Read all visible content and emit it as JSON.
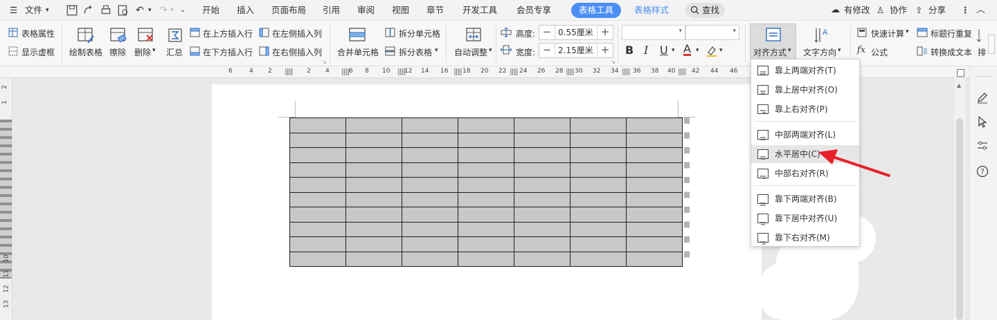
{
  "menubar": {
    "file_label": "文件",
    "tabs": [
      "开始",
      "插入",
      "页面布局",
      "引用",
      "审阅",
      "视图",
      "章节",
      "开发工具",
      "会员专享"
    ],
    "active_tab": "表格工具",
    "style_tab": "表格样式",
    "search_label": "查找",
    "modified_label": "有修改",
    "collab_label": "协作",
    "share_label": "分享"
  },
  "ribbon": {
    "table_props": "表格属性",
    "show_gridlines": "显示虚框",
    "draw_table": "绘制表格",
    "erase": "擦除",
    "delete": "删除",
    "summary": "汇总",
    "insert_row_above": "在上方插入行",
    "insert_row_below": "在下方插入行",
    "insert_col_left": "在左侧插入列",
    "insert_col_right": "在右侧插入列",
    "merge_cells": "合并单元格",
    "split_cells": "拆分单元格",
    "split_table": "拆分表格",
    "auto_fit": "自动调整",
    "height_label": "高度:",
    "height_value": "0.55厘米",
    "width_label": "宽度:",
    "width_value": "2.15厘米",
    "align_mode": "对齐方式",
    "text_direction": "文字方向",
    "quick_calc": "快速计算",
    "repeat_header": "标题行重复",
    "formula": "公式",
    "convert_to_text": "转换成文本",
    "sort_partial": "排",
    "bold": "B",
    "italic": "I",
    "underline": "U",
    "font_color_letter": "A"
  },
  "ruler_ticks": [
    "6",
    "4",
    "2",
    "2",
    "4",
    "6",
    "8",
    "10",
    "12",
    "14",
    "16",
    "18",
    "20",
    "22",
    "24",
    "26",
    "28",
    "30",
    "32",
    "34",
    "36",
    "38",
    "40",
    "42",
    "44",
    "46"
  ],
  "vruler_ticks": [
    "2",
    "1",
    "1",
    "10",
    "11",
    "12",
    "13"
  ],
  "table": {
    "rows": 10,
    "cols": 7
  },
  "dropdown": {
    "items": [
      {
        "label": "靠上两端对齐(T)",
        "icon": "align-top-justify-icon"
      },
      {
        "label": "靠上居中对齐(O)",
        "icon": "align-top-center-icon"
      },
      {
        "label": "靠上右对齐(P)",
        "icon": "align-top-right-icon"
      },
      {
        "label": "中部两端对齐(L)",
        "icon": "align-middle-justify-icon"
      },
      {
        "label": "水平居中(C)",
        "icon": "align-middle-center-icon"
      },
      {
        "label": "中部右对齐(R)",
        "icon": "align-middle-right-icon"
      },
      {
        "label": "靠下两端对齐(B)",
        "icon": "align-bottom-justify-icon"
      },
      {
        "label": "靠下居中对齐(U)",
        "icon": "align-bottom-center-icon"
      },
      {
        "label": "靠下右对齐(M)",
        "icon": "align-bottom-right-icon"
      }
    ],
    "highlighted_label": "水平居中(C)"
  },
  "colors": {
    "accent": "#4a8ef5",
    "arrow": "#e8202a",
    "cell_fill": "#c8c8c8"
  }
}
